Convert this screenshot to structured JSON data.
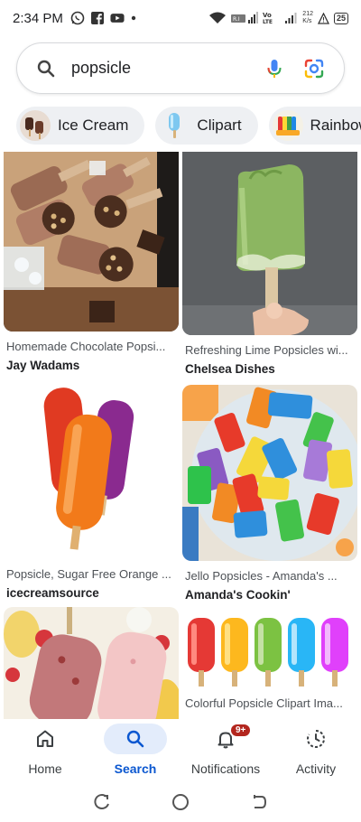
{
  "status_bar": {
    "time": "2:34 PM",
    "network_speed": "212\nK/s",
    "battery": "25",
    "icons": [
      "whatsapp-icon",
      "facebook-icon",
      "youtube-icon",
      "dot-icon",
      "wifi-icon",
      "signal-icon",
      "volte-icon",
      "alert-icon"
    ]
  },
  "search": {
    "query": "popsicle",
    "icons": [
      "search-icon",
      "mic-icon",
      "google-lens-icon"
    ]
  },
  "chips": [
    {
      "label": "Ice Cream"
    },
    {
      "label": "Clipart"
    },
    {
      "label": "Rainbow"
    }
  ],
  "results": [
    {
      "title": "Homemade Chocolate Popsi...",
      "source": "Jay Wadams"
    },
    {
      "title": "Refreshing Lime Popsicles wi...",
      "source": "Chelsea Dishes"
    },
    {
      "title": "Popsicle, Sugar Free Orange ...",
      "source": "icecreamsource"
    },
    {
      "title": "Jello Popsicles - Amanda's ...",
      "source": "Amanda's Cookin'"
    },
    {
      "title": "",
      "source": ""
    },
    {
      "title": "Colorful Popsicle Clipart Ima...",
      "source": ""
    }
  ],
  "bottom_nav": [
    {
      "label": "Home",
      "icon": "home-icon"
    },
    {
      "label": "Search",
      "icon": "search-icon",
      "active": true
    },
    {
      "label": "Notifications",
      "icon": "bell-icon",
      "badge": "9+"
    },
    {
      "label": "Activity",
      "icon": "activity-icon"
    }
  ],
  "colors": {
    "accent": "#0b57d0",
    "active_nav_bg": "#e3ecfb",
    "chip_bg": "#eef0f3",
    "badge": "#b3261e"
  }
}
